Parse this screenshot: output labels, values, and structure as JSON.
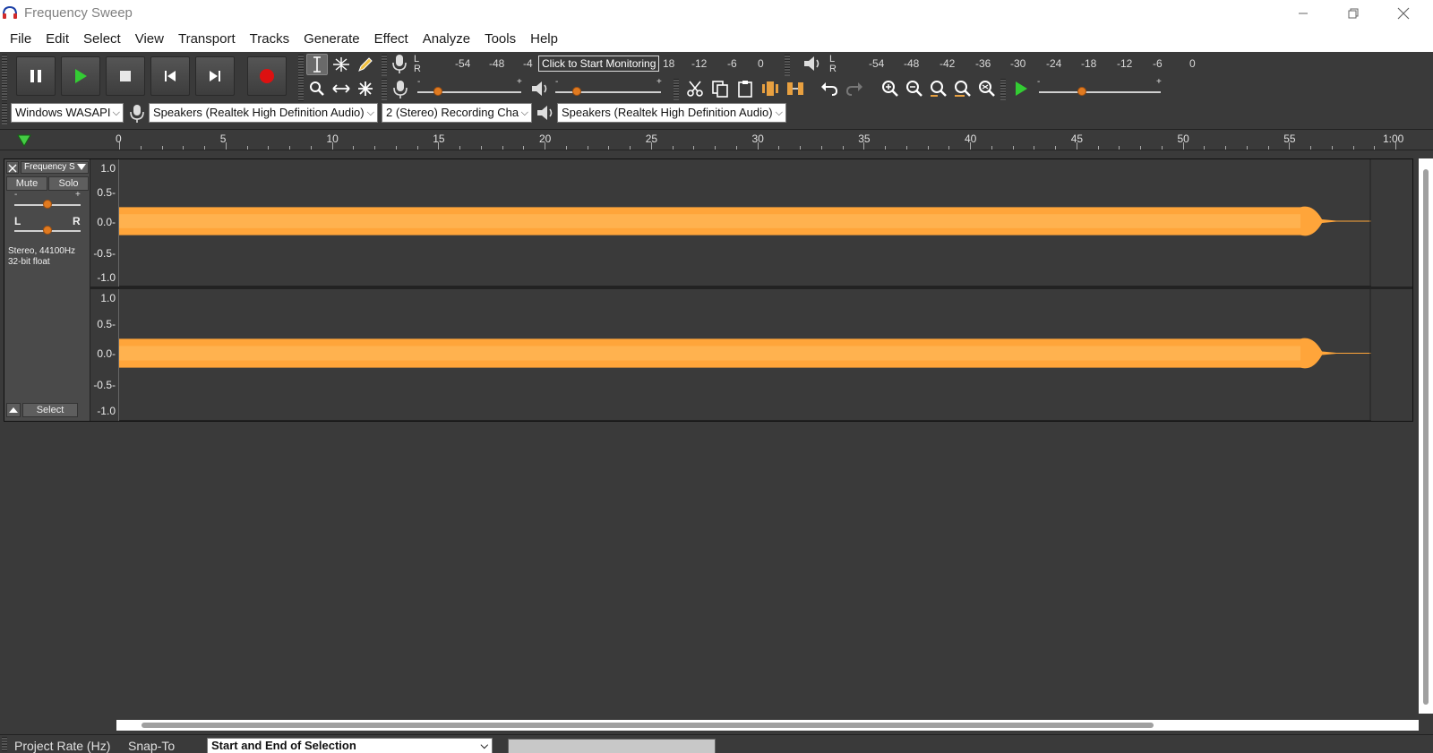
{
  "window": {
    "title": "Frequency Sweep",
    "controls": [
      "minimize",
      "restore",
      "close"
    ]
  },
  "menu": [
    "File",
    "Edit",
    "Select",
    "View",
    "Transport",
    "Tracks",
    "Generate",
    "Effect",
    "Analyze",
    "Tools",
    "Help"
  ],
  "transport": {
    "buttons": [
      "pause-icon",
      "play-icon",
      "stop-icon",
      "skip-start-icon",
      "skip-end-icon",
      "record-icon"
    ],
    "colors": {
      "play": "#33cc33",
      "record": "#dd1111"
    }
  },
  "tools": [
    "selection-tool",
    "envelope-tool",
    "draw-tool",
    "zoom-tool",
    "timeshift-tool",
    "multi-tool"
  ],
  "meters": {
    "record_lr": [
      "L",
      "R"
    ],
    "record_scale": [
      "-54",
      "-48",
      "-4",
      "18",
      "-12",
      "-6",
      "0"
    ],
    "monitor_tooltip": "Click to Start Monitoring",
    "playback_lr": [
      "L",
      "R"
    ],
    "playback_scale": [
      "-54",
      "-48",
      "-42",
      "-36",
      "-30",
      "-24",
      "-18",
      "-12",
      "-6",
      "0"
    ]
  },
  "mixer": {
    "minus": "-",
    "plus": "+",
    "record_volume": 0.2,
    "playback_volume": 0.2,
    "play_at_speed": 0.35
  },
  "edit_tools": [
    "cut-icon",
    "copy-icon",
    "paste-icon",
    "trim-icon",
    "silence-icon",
    "undo-icon",
    "redo-icon",
    "zoom-in-icon",
    "zoom-out-icon",
    "fit-selection-icon",
    "fit-project-icon",
    "zoom-toggle-icon",
    "play-at-speed-icon"
  ],
  "devices": {
    "host": "Windows WASAPI",
    "recording_device": "Speakers (Realtek High Definition Audio)",
    "channels": "2 (Stereo) Recording Chan",
    "playback_device": "Speakers (Realtek High Definition Audio)"
  },
  "ruler": {
    "labels": [
      "0",
      "5",
      "10",
      "15",
      "20",
      "25",
      "30",
      "35",
      "40",
      "45",
      "50",
      "55",
      "1:00"
    ]
  },
  "track": {
    "name": "Frequency S",
    "mute": "Mute",
    "solo": "Solo",
    "pan_left": "L",
    "pan_right": "R",
    "gain_minus": "-",
    "gain_plus": "+",
    "info_line1": "Stereo, 44100Hz",
    "info_line2": "32-bit float",
    "select": "Select",
    "scale": [
      "1.0",
      "0.5-",
      "0.0-",
      "-0.5-",
      "-1.0"
    ],
    "wave_color": "#ffa53a",
    "wave_end_fraction": 0.965
  },
  "statusbar": {
    "project_rate": "Project Rate (Hz)",
    "snap_to": "Snap-To",
    "selection_mode": "Start and End of Selection"
  }
}
